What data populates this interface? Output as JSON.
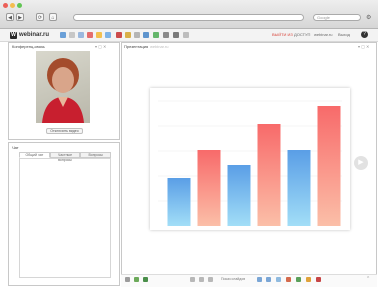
{
  "browser": {
    "search_placeholder": "Google",
    "nav": {
      "back": "◀",
      "forward": "▶",
      "reload": "⟳",
      "home": "⌂"
    }
  },
  "toolbar": {
    "logo_mark": "W",
    "logo_text": "webinar.ru",
    "right_links": [
      "ВЫЙТИ ИЗ",
      "ДОСТУП",
      "webinar.ru",
      "Выход"
    ]
  },
  "conference": {
    "title": "Конференц-связь",
    "button_label": "Отключить видео"
  },
  "chat": {
    "title": "Чат",
    "tabs": [
      "Общий чат",
      "Частные вопросы",
      "Вопросы"
    ]
  },
  "presentation": {
    "title": "Презентация",
    "subtitle": "webinar.ru"
  },
  "chart_data": {
    "type": "bar",
    "categories": [
      "1",
      "2",
      "3",
      "4",
      "5",
      "6"
    ],
    "values": [
      48,
      76,
      61,
      102,
      76,
      120
    ],
    "colors": [
      "#5aa0e8",
      "#f86a6a",
      "#5aa0e8",
      "#f86a6a",
      "#5aa0e8",
      "#f86a6a"
    ],
    "ylim": [
      0,
      130
    ],
    "grid": true
  },
  "bottom": {
    "center_text": "Показ слайдов"
  },
  "colors": {
    "accent_red": "#f86a6a",
    "accent_blue": "#5aa0e8"
  }
}
